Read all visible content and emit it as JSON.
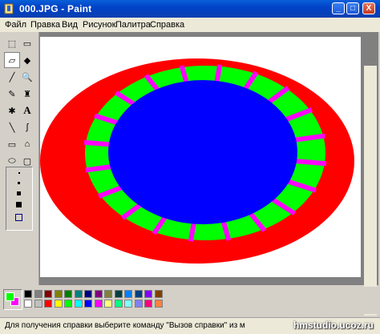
{
  "window": {
    "title": "000.JPG - Paint",
    "minimize": "_",
    "maximize": "□",
    "close": "X"
  },
  "menu": [
    "Файл",
    "Правка",
    "Вид",
    "Рисунок",
    "Палитра",
    "Справка"
  ],
  "tools": [
    {
      "name": "free-select-icon",
      "glyph": "⬚"
    },
    {
      "name": "rect-select-icon",
      "glyph": "▭"
    },
    {
      "name": "eraser-icon",
      "glyph": "▱"
    },
    {
      "name": "fill-bucket-icon",
      "glyph": "◆"
    },
    {
      "name": "color-picker-icon",
      "glyph": "╱"
    },
    {
      "name": "magnifier-icon",
      "glyph": "🔍"
    },
    {
      "name": "pencil-icon",
      "glyph": "✎"
    },
    {
      "name": "brush-icon",
      "glyph": "♜"
    },
    {
      "name": "airbrush-icon",
      "glyph": "✱"
    },
    {
      "name": "text-tool-icon",
      "glyph": "A"
    },
    {
      "name": "line-icon",
      "glyph": "╲"
    },
    {
      "name": "curve-icon",
      "glyph": "∫"
    },
    {
      "name": "rectangle-icon",
      "glyph": "▭"
    },
    {
      "name": "polygon-icon",
      "glyph": "⌂"
    },
    {
      "name": "ellipse-icon",
      "glyph": "⬭"
    },
    {
      "name": "rounded-rect-icon",
      "glyph": "▢"
    }
  ],
  "palette": {
    "top": [
      "#000000",
      "#808080",
      "#800000",
      "#808000",
      "#008000",
      "#008080",
      "#000080",
      "#800080",
      "#808040",
      "#004040",
      "#0080ff",
      "#004080",
      "#8000ff",
      "#804000"
    ],
    "bottom": [
      "#ffffff",
      "#c0c0c0",
      "#ff0000",
      "#ffff00",
      "#00ff00",
      "#00ffff",
      "#0000ff",
      "#ff00ff",
      "#ffff80",
      "#00ff80",
      "#80ffff",
      "#8080ff",
      "#ff0080",
      "#ff8040"
    ],
    "foreground": "#00ff00",
    "background": "#ff00ff"
  },
  "drawing": {
    "outer": "#ff0000",
    "middle": "#00ff00",
    "inner": "#0000ff",
    "stripes": "#ff00ff"
  },
  "status": "Для получения справки выберите команду \"Вызов справки\" из м",
  "watermark": "hmstudio.ucoz.ru"
}
